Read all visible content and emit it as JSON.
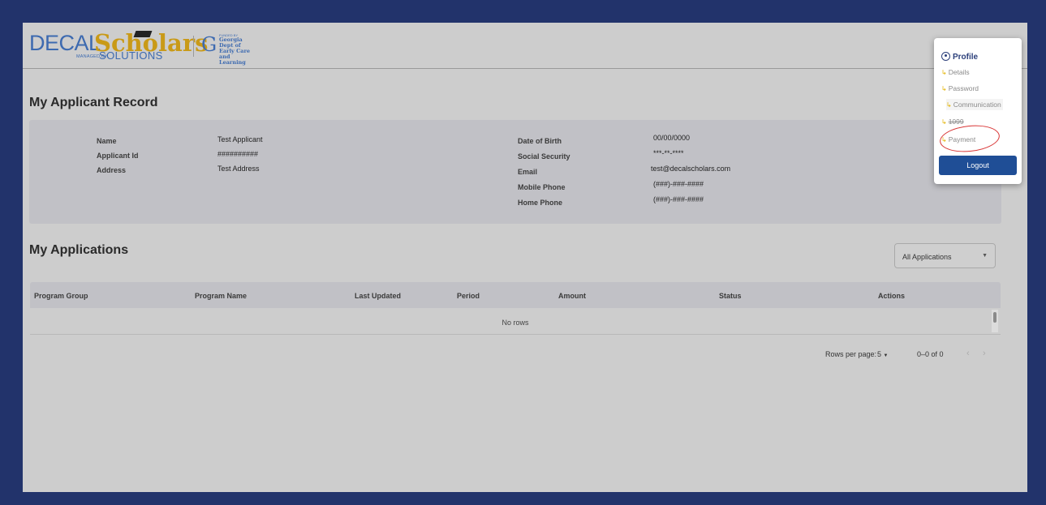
{
  "brand": {
    "decal": "DECAL",
    "scholars": "Scholars",
    "managed_by": "MANAGED BY",
    "solutions": "SOLUTIONS",
    "funded_by": "FUNDED BY",
    "dept_name": "Georgia Dept of Early Care and Learning"
  },
  "record": {
    "title": "My Applicant Record",
    "left_fields": [
      {
        "label": "Name",
        "value": "Test Applicant"
      },
      {
        "label": "Applicant Id",
        "value": "##########"
      },
      {
        "label": "Address",
        "value": "Test Address"
      }
    ],
    "right_fields": [
      {
        "label": "Date of Birth",
        "value": "00/00/0000"
      },
      {
        "label": "Social Security",
        "value": "***-**-****"
      },
      {
        "label": "Email",
        "value": "test@decalscholars.com"
      },
      {
        "label": "Mobile Phone",
        "value": "(###)-###-####"
      },
      {
        "label": "Home Phone",
        "value": "(###)-###-####"
      }
    ]
  },
  "applications": {
    "title": "My Applications",
    "filter": "All Applications",
    "columns": [
      "Program Group",
      "Program Name",
      "Last Updated",
      "Period",
      "Amount",
      "Status",
      "Actions"
    ],
    "rows": [],
    "empty_text": "No rows"
  },
  "pagination": {
    "rows_per_page_label": "Rows per page:",
    "rows_per_page": "5",
    "range": "0–0 of 0"
  },
  "profile_menu": {
    "title": "Profile",
    "items": [
      "Details",
      "Password",
      "Communication",
      "1099",
      "Payment"
    ],
    "logout": "Logout"
  },
  "colors": {
    "frame": "#22336b",
    "brand_blue": "#3d6ab0",
    "brand_gold": "#c99a17",
    "logout_button": "#1f4e96",
    "highlight_circle": "#d83333"
  }
}
